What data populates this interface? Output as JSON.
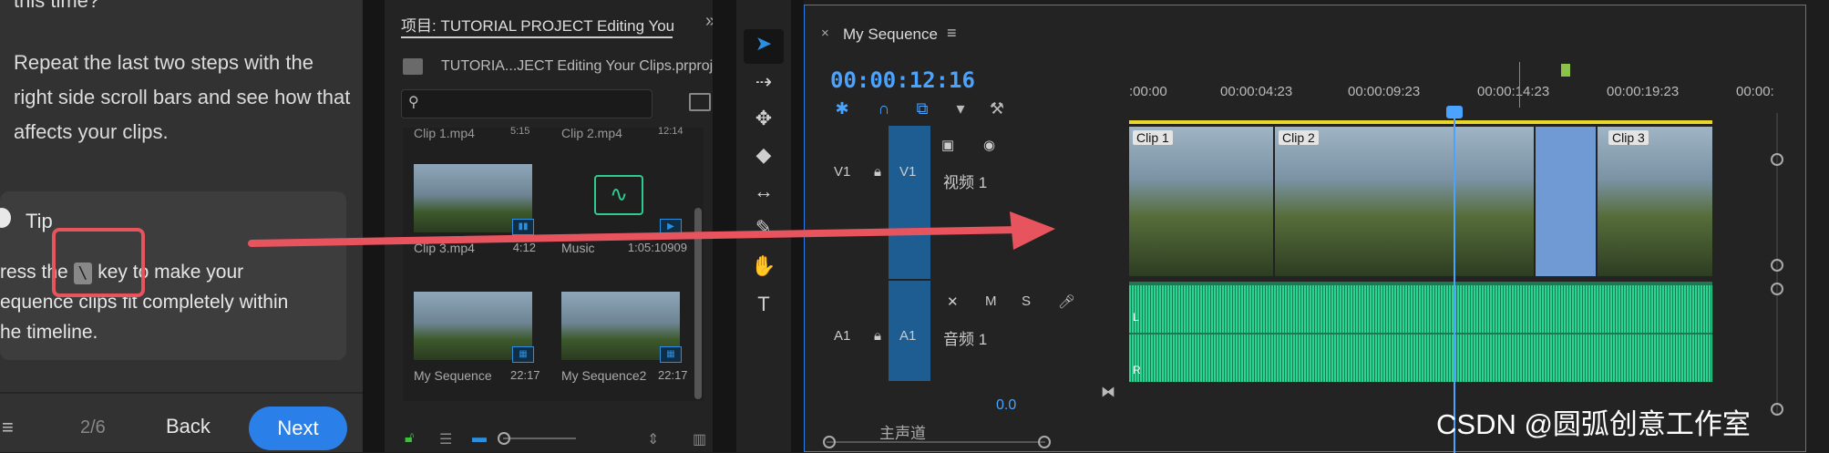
{
  "tutorial": {
    "question": "this time?",
    "paragraph": "Repeat the last two steps with the right side scroll bars and see how that affects your clips.",
    "tip_title": "Tip",
    "tip_before": "ress the ",
    "tip_key": "\\",
    "tip_after": " key to make your",
    "tip_line2": "equence clips fit completely within",
    "tip_line3": "he timeline.",
    "page": "2/6",
    "back_label": "Back",
    "next_label": "Next",
    "accent": "#2b7fe8",
    "highlight": "#e8545e"
  },
  "project": {
    "tab_title": "项目: TUTORIAL PROJECT Editing Your C",
    "file_name": "TUTORIA...JECT Editing Your Clips.prproj",
    "search_placeholder": "",
    "top_items": [
      {
        "name": "Clip 1.mp4",
        "duration": "5:15"
      },
      {
        "name": "Clip 2.mp4",
        "duration": "12:14"
      }
    ],
    "items": [
      {
        "name": "Clip 3.mp4",
        "duration": "4:12"
      },
      {
        "name": "Music",
        "duration": "1:05:10909"
      },
      {
        "name": "My Sequence",
        "duration": "22:17"
      },
      {
        "name": "My Sequence2",
        "duration": "22:17"
      }
    ]
  },
  "tools": [
    "selection-tool",
    "track-select-tool",
    "ripple-edit-tool",
    "razor-tool",
    "slip-tool",
    "pen-tool",
    "hand-tool",
    "type-tool"
  ],
  "timeline": {
    "sequence_name": "My Sequence",
    "timecode": "00:00:12:16",
    "ruler": [
      ":00:00",
      "00:00:04:23",
      "00:00:09:23",
      "00:00:14:23",
      "00:00:19:23",
      "00:00:"
    ],
    "v1_label": "V1",
    "v1_name": "视频 1",
    "a1_label": "A1",
    "a1_name": "音频 1",
    "a1_m": "M",
    "a1_s": "S",
    "clips": [
      "Clip 1",
      "Clip 2",
      "Clip 3"
    ],
    "master_value": "0.0",
    "master_name": "主声道",
    "audio_l": "L",
    "audio_r": "R"
  },
  "watermark": "CSDN @圆弧创意工作室"
}
